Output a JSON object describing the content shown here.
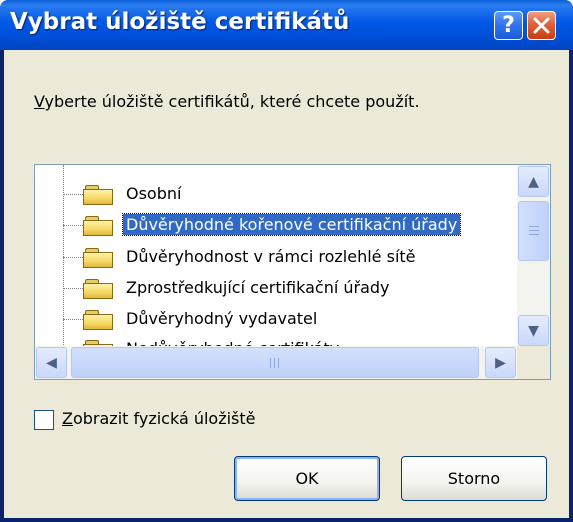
{
  "dialog": {
    "title": "Vybrat úložiště certifikátů",
    "help_symbol": "?",
    "close_symbol": "✕",
    "prompt_first": "V",
    "prompt_rest": "yberte úložiště certifikátů, které chcete použít."
  },
  "tree": {
    "items": [
      {
        "label": "Osobní"
      },
      {
        "label": "Důvěryhodné kořenové certifikační úřady",
        "selected": true
      },
      {
        "label": "Důvěryhodnost v rámci rozlehlé sítě"
      },
      {
        "label": "Zprostředkující certifikační úřady"
      },
      {
        "label": "Důvěryhodný vydavatel"
      },
      {
        "label": "Nedůvěryhodné certifikáty"
      }
    ]
  },
  "scroll": {
    "up": "▲",
    "down": "▼",
    "left": "◀",
    "right": "▶"
  },
  "options": {
    "show_physical_first": "Z",
    "show_physical_rest": "obrazit fyzická úložiště",
    "show_physical_checked": false
  },
  "buttons": {
    "ok": "OK",
    "cancel": "Storno"
  },
  "colors": {
    "titlebar": "#0058e6",
    "selection": "#316ac5",
    "dialog_bg": "#ece9d8",
    "close_button": "#e2603a"
  }
}
